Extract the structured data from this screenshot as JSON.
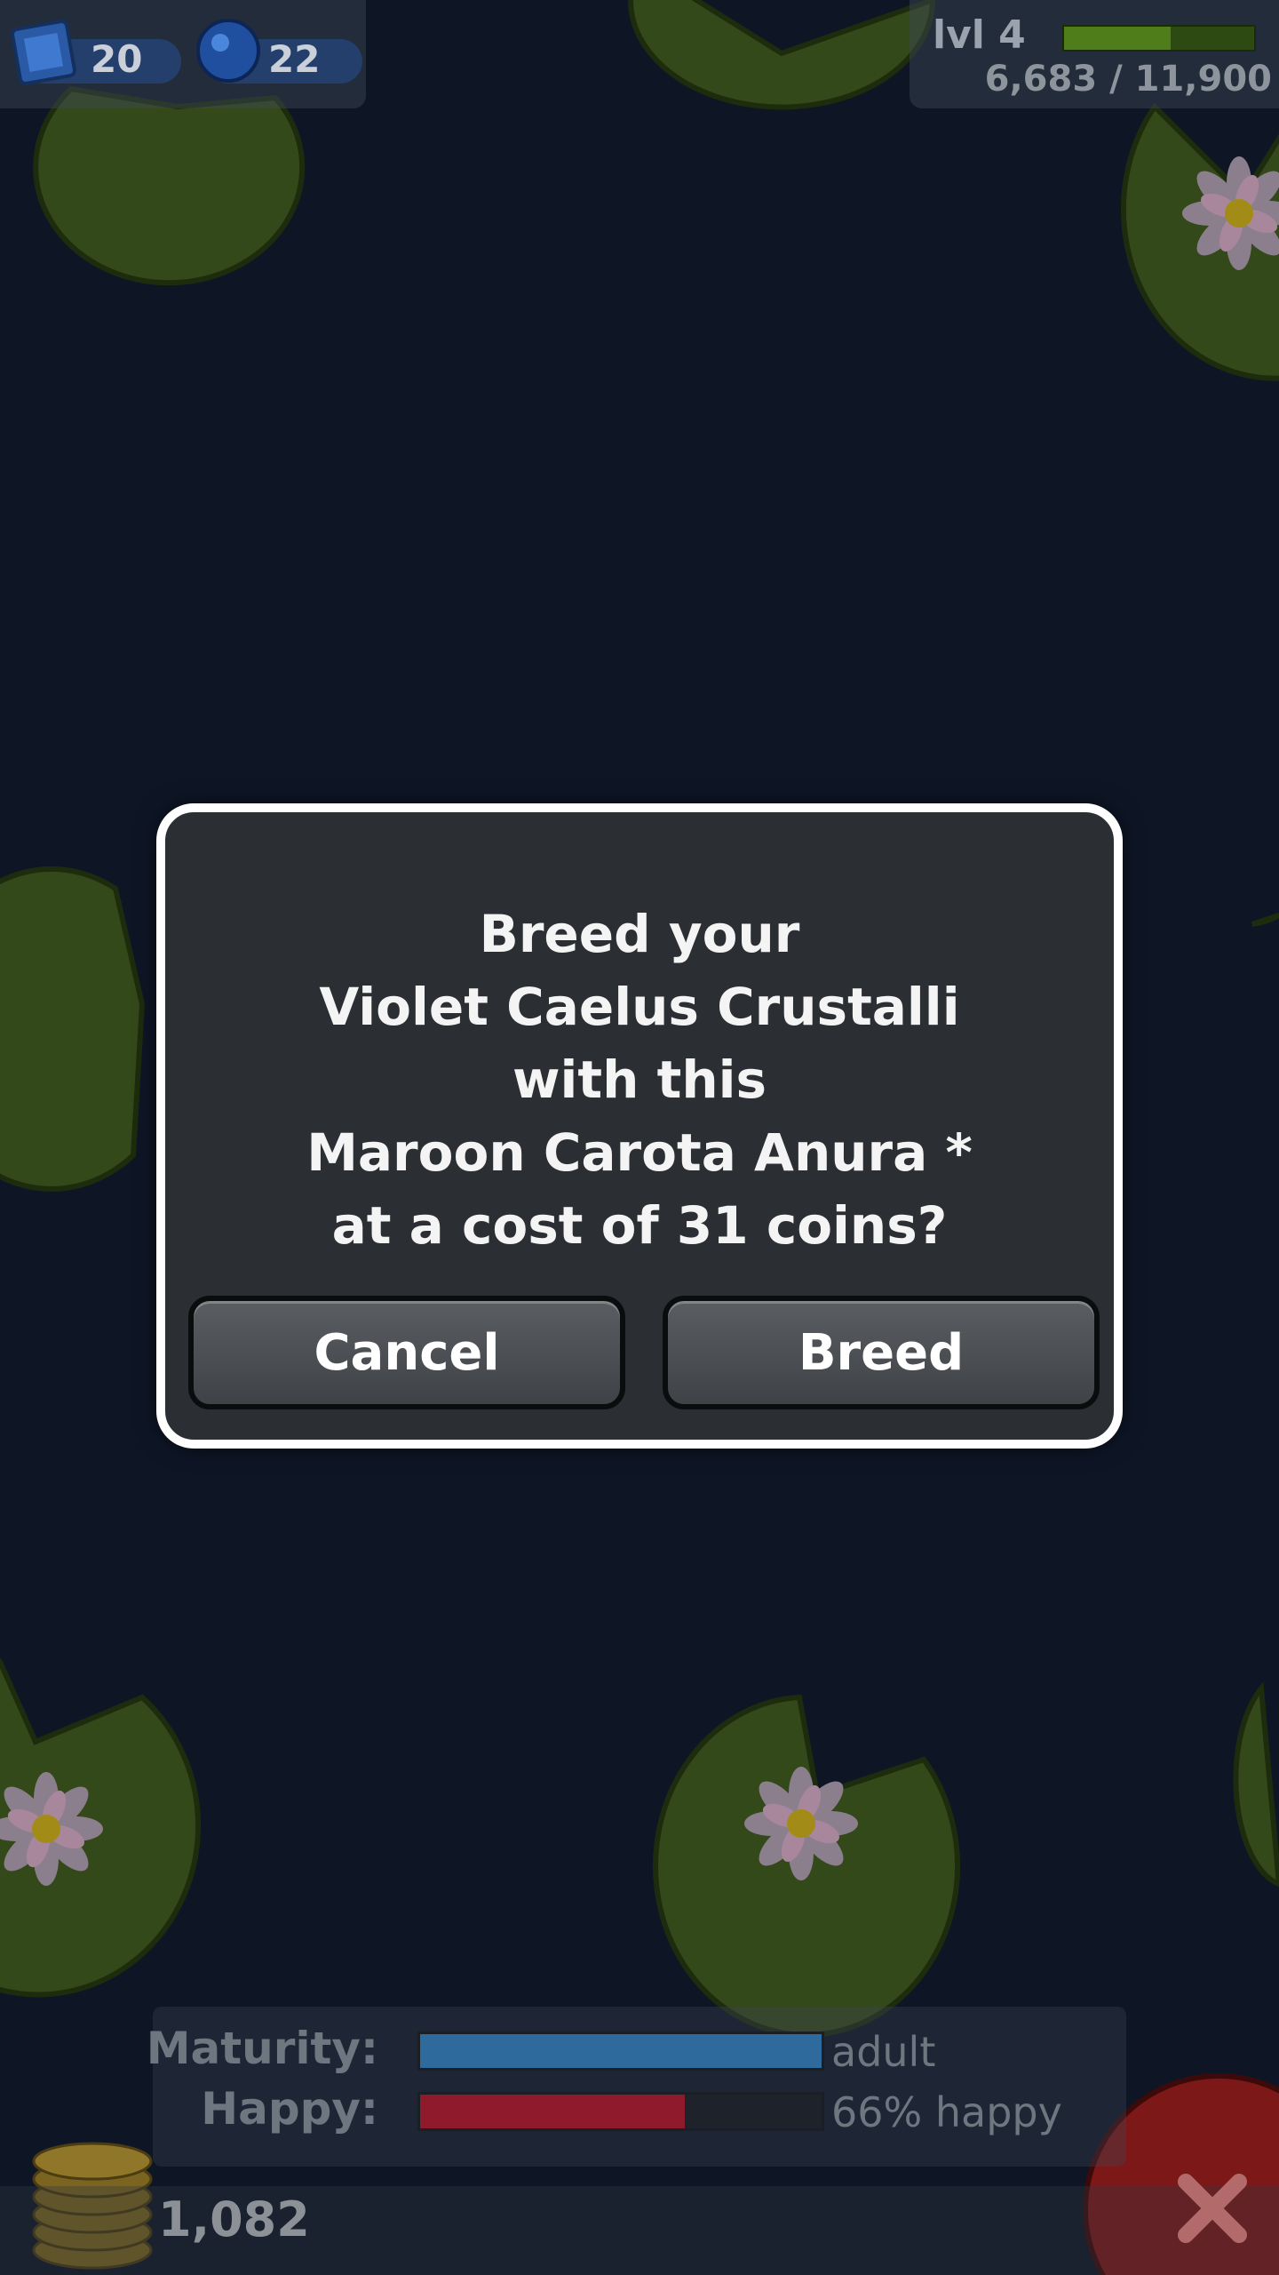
{
  "hud": {
    "stamp_count": "20",
    "gem_count": "22",
    "level_label": "lvl 4",
    "xp_text": "6,683 / 11,900",
    "xp_progress": 0.56
  },
  "dialog": {
    "lines": [
      "Breed your",
      "Violet Caelus Crustalli",
      "with this",
      "Maroon Carota Anura *",
      "at a cost of 31 coins?"
    ],
    "cancel_label": "Cancel",
    "breed_label": "Breed"
  },
  "status": {
    "maturity_label": "Maturity:",
    "maturity_value": "adult",
    "maturity_progress": 1.0,
    "happy_label": "Happy:",
    "happy_value": "66% happy",
    "happy_progress": 0.66
  },
  "coins": "1,082",
  "colors": {
    "maturity_bar": "#2f6a9c",
    "happy_bar": "#8e1a2c",
    "close_button": "#8a1c1c"
  },
  "icons": [
    "stamp-icon",
    "gem-icon",
    "coins-icon",
    "close-icon",
    "lily-pad-icon",
    "water-lily-icon"
  ]
}
